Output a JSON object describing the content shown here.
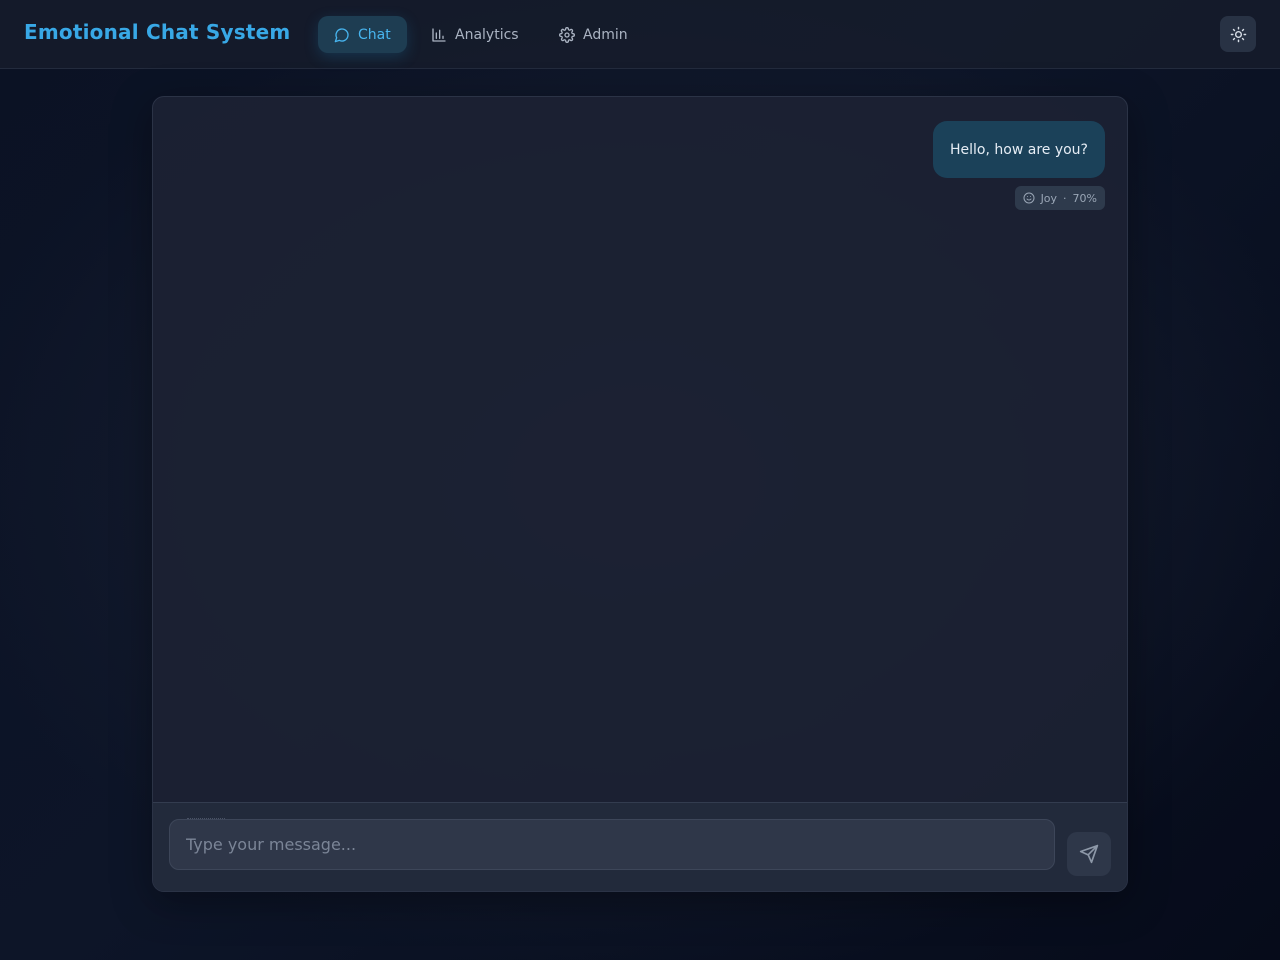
{
  "app": {
    "title": "Emotional Chat System"
  },
  "nav": {
    "items": [
      {
        "label": "Chat",
        "icon": "message-circle-icon",
        "active": true
      },
      {
        "label": "Analytics",
        "icon": "bar-chart-icon",
        "active": false
      },
      {
        "label": "Admin",
        "icon": "gear-icon",
        "active": false
      }
    ]
  },
  "header": {
    "theme_toggle_icon": "sun-icon"
  },
  "chat": {
    "messages": [
      {
        "sender": "user",
        "text": "Hello, how are you?",
        "emotion": "Joy",
        "confidence": "70%"
      }
    ]
  },
  "composer": {
    "placeholder": "Type your message...",
    "value": "",
    "send_icon": "send-icon"
  },
  "colors": {
    "accent": "#38a8e6",
    "active_nav_bg": "#1e3d52",
    "user_bubble": "#1b4159",
    "background": "#0b1224"
  }
}
